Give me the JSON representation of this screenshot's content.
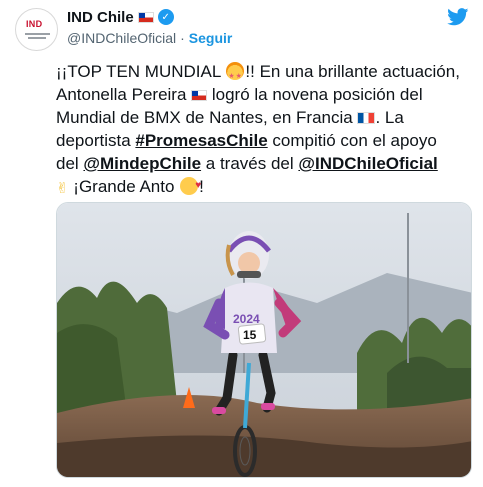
{
  "account": {
    "display_name": "IND Chile",
    "handle": "@INDChileOficial",
    "separator": "·",
    "follow_label": "Seguir",
    "avatar_text": "IND"
  },
  "tweet": {
    "line1_a": "¡¡TOP TEN MUNDIAL ",
    "line1_b": "!! En una brillante actuación,",
    "line2_a": "Antonella Pereira ",
    "line2_b": " logró la novena posición del",
    "line3": "Mundial de BMX de Nantes, en Francia ",
    "line3_end": ". La",
    "line4_a": "deportista ",
    "hashtag": "#PromesasChile",
    "line4_b": " compitió con el apoyo",
    "line5_a": "del ",
    "mention1": "@MindepChile",
    "line5_b": " a través del ",
    "mention2": "@INDChileOficial",
    "line6_a": "✌",
    "line6_b": " ¡Grande Anto ",
    "line6_c": "!"
  },
  "photo": {
    "bib_number": "15",
    "jersey_text": "2024"
  },
  "colors": {
    "link": "#1b95e0",
    "twitter_blue": "#1d9bf0",
    "text": "#0f1419",
    "muted": "#536471"
  },
  "icons": [
    "twitter-bird-icon",
    "verified-icon",
    "chile-flag-icon",
    "france-flag-icon",
    "star-struck-emoji",
    "smiling-hearts-emoji",
    "victory-hand-emoji"
  ]
}
